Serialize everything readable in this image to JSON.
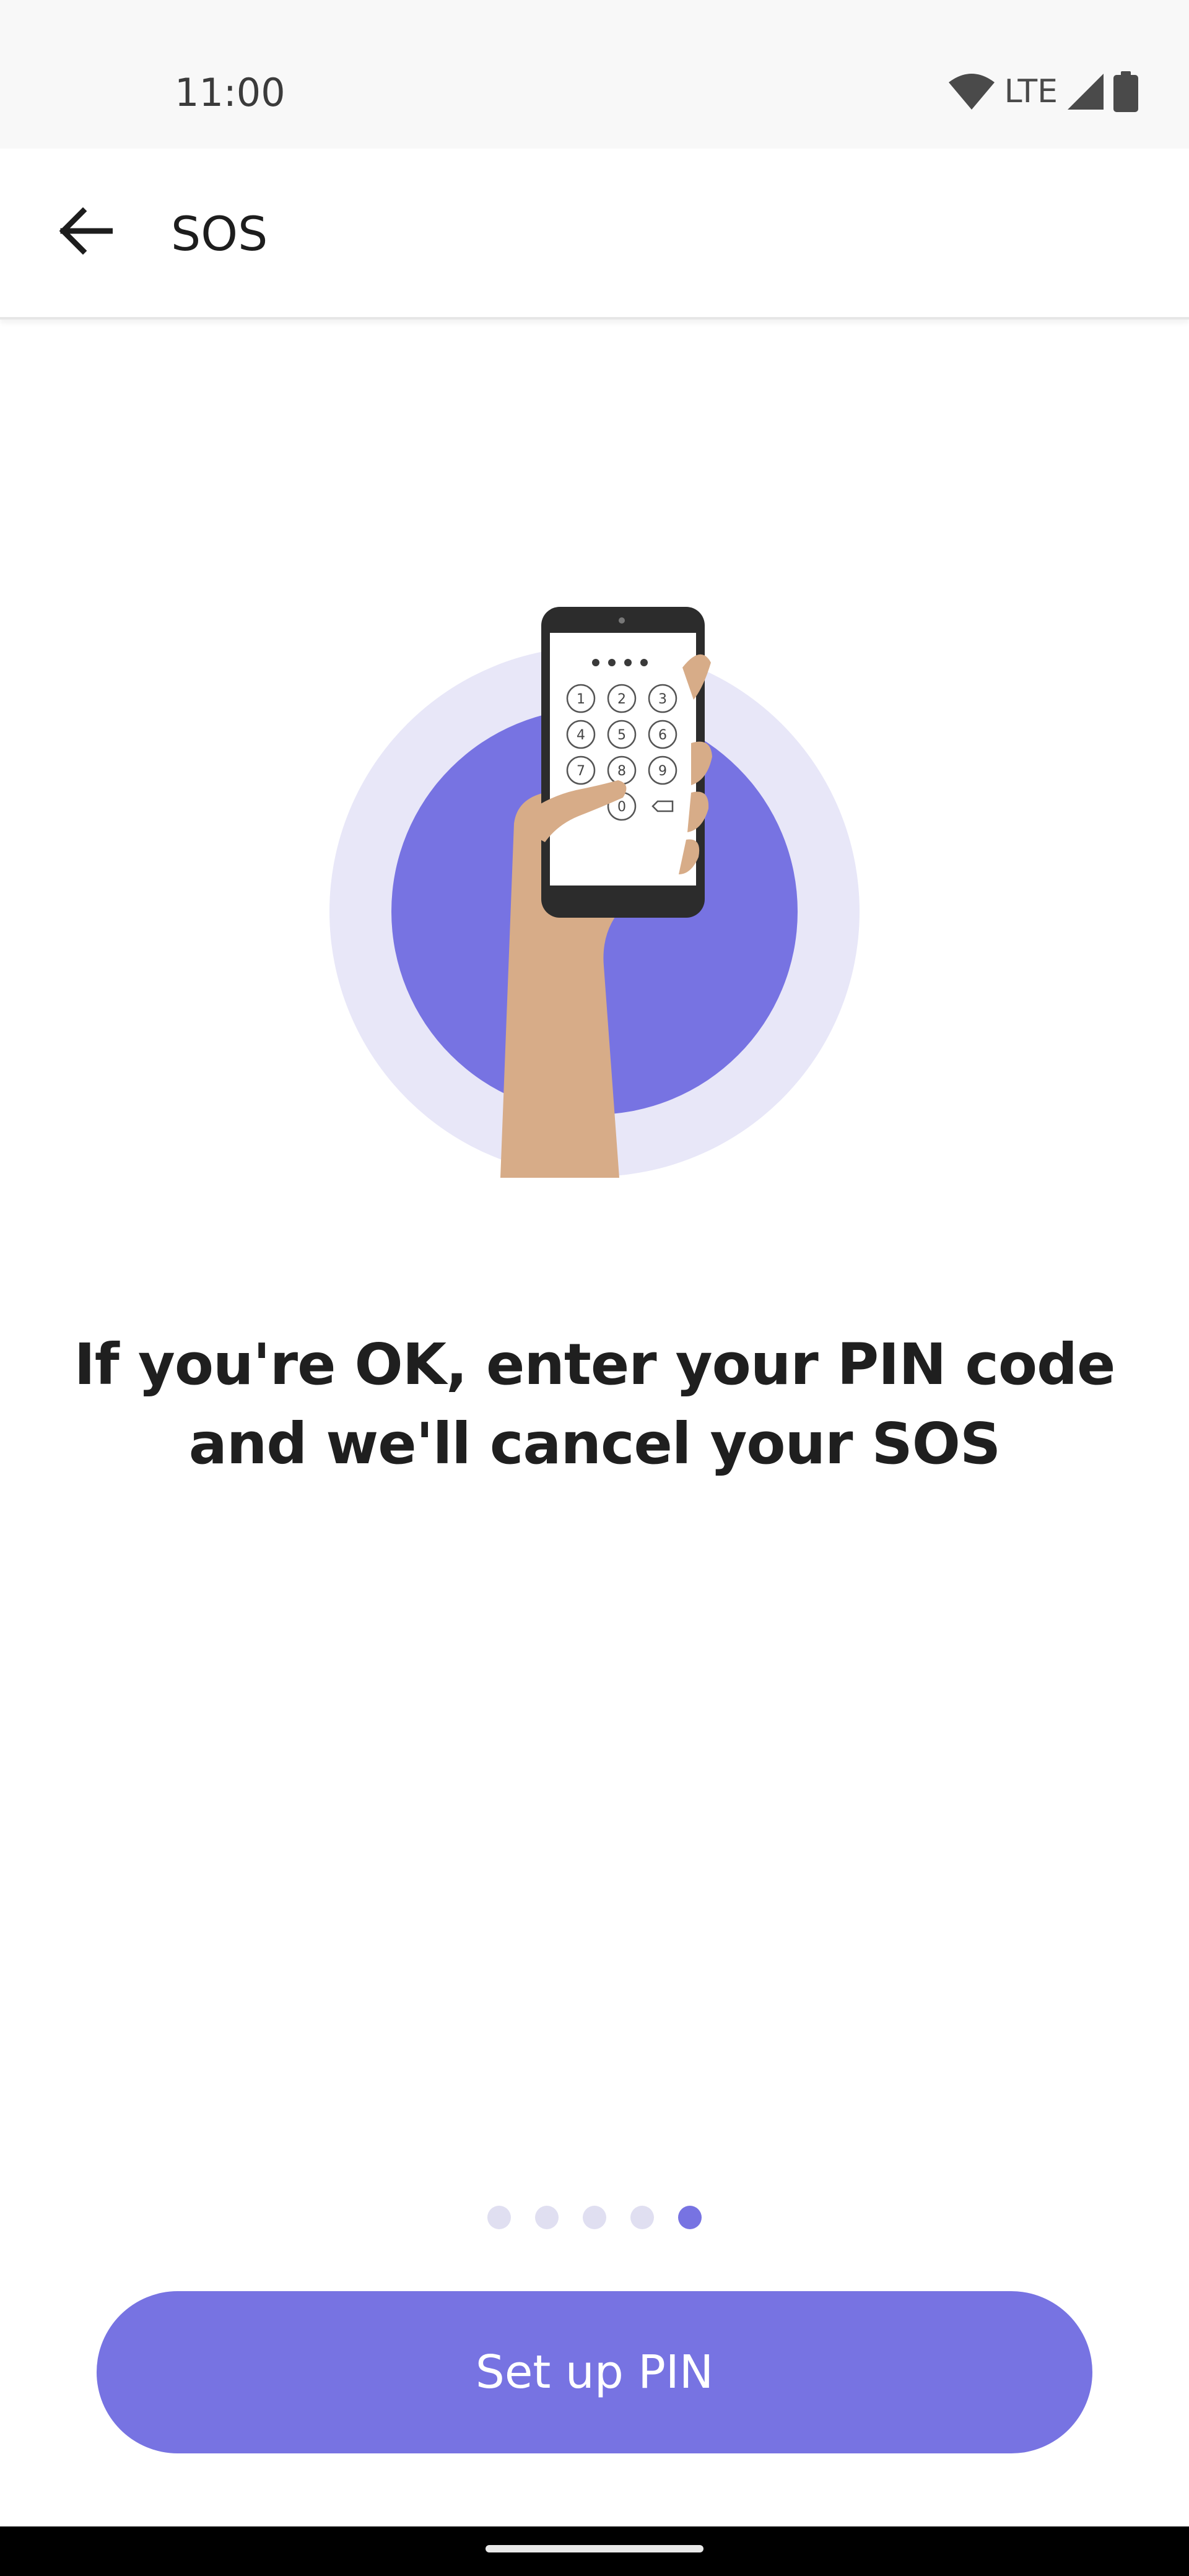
{
  "status_bar": {
    "time": "11:00",
    "network_label": "LTE",
    "icons": [
      "wifi-icon",
      "cell-signal-icon",
      "battery-icon"
    ]
  },
  "app_bar": {
    "back_icon": "arrow-left-icon",
    "title": "SOS"
  },
  "illustration": {
    "subject": "hand-holding-phone-pin-pad",
    "keypad_keys": [
      "1",
      "2",
      "3",
      "4",
      "5",
      "6",
      "7",
      "8",
      "9",
      "0"
    ],
    "pin_mask": "••••"
  },
  "main": {
    "heading": "If you're OK, enter your PIN code and we'll cancel your SOS"
  },
  "pager": {
    "total": 5,
    "active_index": 4
  },
  "cta": {
    "label": "Set up PIN"
  },
  "colors": {
    "accent": "#7773e2",
    "accent_light": "#e8e7f8",
    "dot_inactive": "#e0dff1",
    "skin": "#d7ac88",
    "phone_body": "#2c2c2c"
  }
}
